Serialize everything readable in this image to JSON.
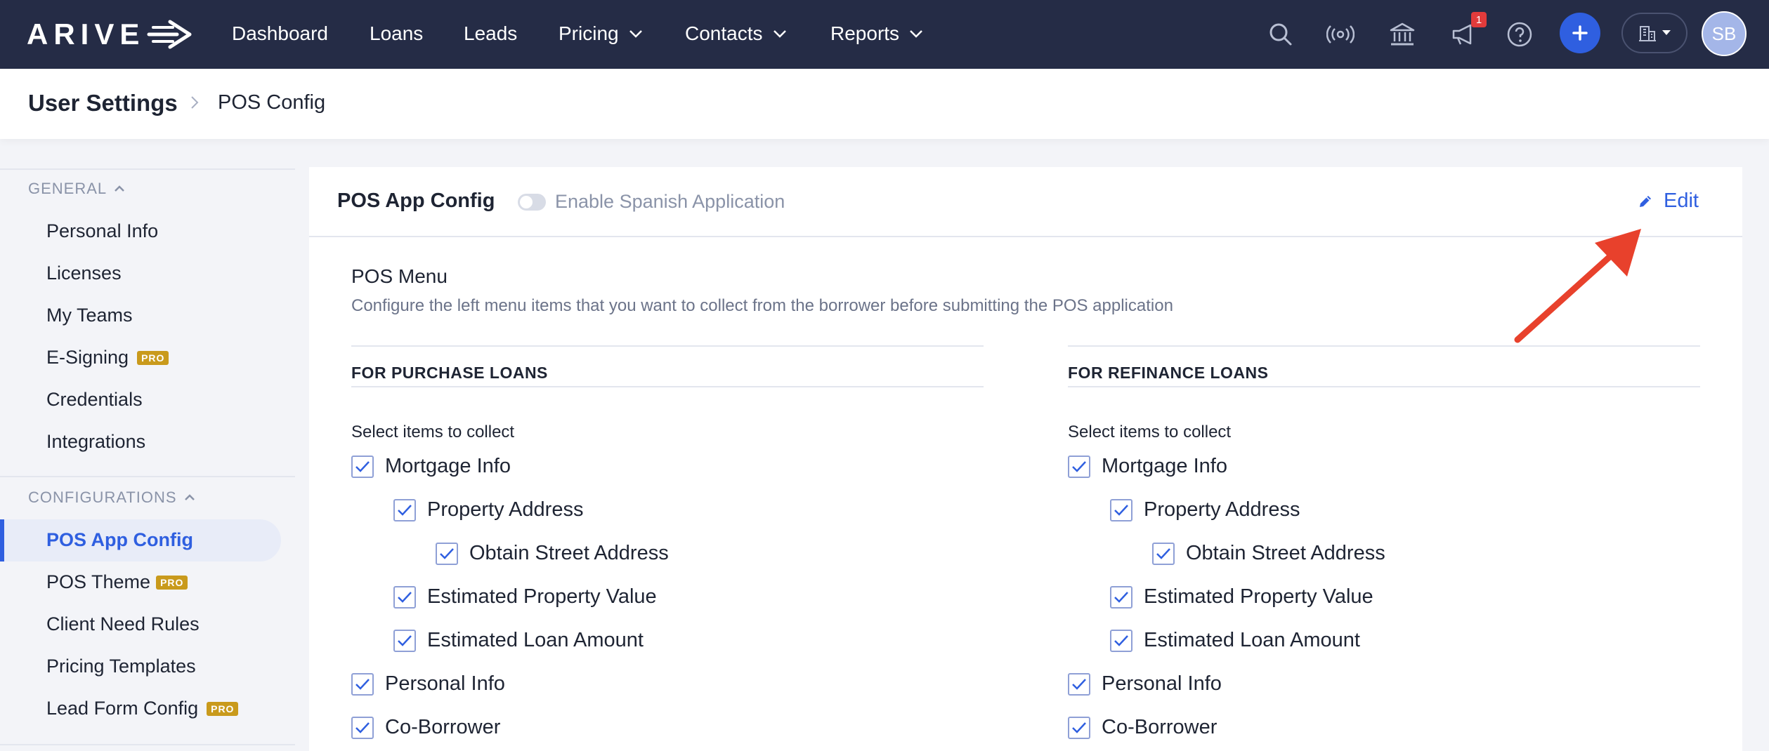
{
  "brand": {
    "logo_text": "ARIVE"
  },
  "nav": {
    "items": [
      {
        "label": "Dashboard"
      },
      {
        "label": "Loans"
      },
      {
        "label": "Leads"
      },
      {
        "label": "Pricing"
      },
      {
        "label": "Contacts"
      },
      {
        "label": "Reports"
      }
    ],
    "notification_count": "1",
    "avatar_initials": "SB"
  },
  "breadcrumb": {
    "title": "User Settings",
    "current": "POS Config"
  },
  "sidebar": {
    "general_label": "GENERAL",
    "general_items": [
      {
        "label": "Personal Info"
      },
      {
        "label": "Licenses"
      },
      {
        "label": "My Teams"
      },
      {
        "label": "E-Signing",
        "badge": "PRO"
      },
      {
        "label": "Credentials"
      },
      {
        "label": "Integrations"
      }
    ],
    "config_label": "CONFIGURATIONS",
    "config_items": [
      {
        "label": "POS App Config"
      },
      {
        "label": "POS Theme",
        "badge": "PRO"
      },
      {
        "label": "Client Need Rules"
      },
      {
        "label": "Pricing Templates"
      },
      {
        "label": "Lead Form Config",
        "badge": "PRO"
      }
    ]
  },
  "card": {
    "title": "POS App Config",
    "toggle_label": "Enable Spanish Application",
    "edit_label": "Edit",
    "menu_title": "POS Menu",
    "menu_desc": "Configure the left menu items that you want to collect from the borrower before submitting the POS application",
    "purchase": {
      "title": "FOR PURCHASE LOANS",
      "subtitle": "Select items to collect",
      "items": [
        {
          "label": "Mortgage Info",
          "checked": true
        },
        {
          "label": "Property Address",
          "checked": true
        },
        {
          "label": "Obtain Street Address",
          "checked": true
        },
        {
          "label": "Estimated Property Value",
          "checked": true
        },
        {
          "label": "Estimated Loan Amount",
          "checked": true
        },
        {
          "label": "Personal Info",
          "checked": true
        },
        {
          "label": "Co-Borrower",
          "checked": true
        }
      ]
    },
    "refinance": {
      "title": "FOR REFINANCE LOANS",
      "subtitle": "Select items to collect",
      "items": [
        {
          "label": "Mortgage Info",
          "checked": true
        },
        {
          "label": "Property Address",
          "checked": true
        },
        {
          "label": "Obtain Street Address",
          "checked": true
        },
        {
          "label": "Estimated Property Value",
          "checked": true
        },
        {
          "label": "Estimated Loan Amount",
          "checked": true
        },
        {
          "label": "Personal Info",
          "checked": true
        },
        {
          "label": "Co-Borrower",
          "checked": true
        }
      ]
    }
  },
  "colors": {
    "nav_bg": "#252c46",
    "accent": "#2f5fe0",
    "pro_badge": "#c99a1c",
    "annotation_arrow": "#e8412c"
  }
}
